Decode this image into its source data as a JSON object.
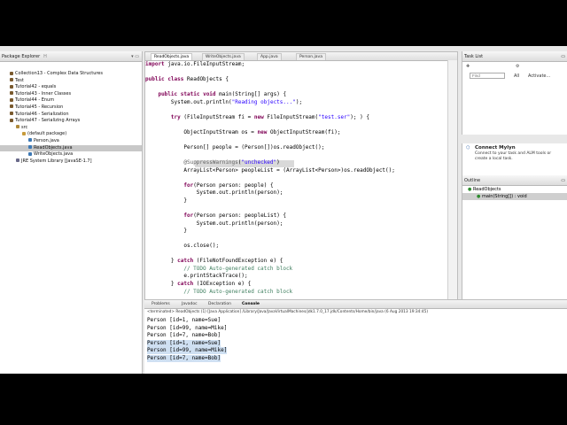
{
  "package_explorer": {
    "title": "Package Explorer",
    "hierarchy_label": "H",
    "items": [
      {
        "label": "Collection13 - Complex Data Structures",
        "indent": 1
      },
      {
        "label": "Test",
        "indent": 1
      },
      {
        "label": "Tutorial42 - equals",
        "indent": 1
      },
      {
        "label": "Tutorial43 - Inner Classes",
        "indent": 1
      },
      {
        "label": "Tutorial44 - Enum",
        "indent": 1
      },
      {
        "label": "Tutorial45 - Recursion",
        "indent": 1
      },
      {
        "label": "Tutorial46 - Serialization",
        "indent": 1
      },
      {
        "label": "Tutorial47 - Serializing Arrays",
        "indent": 1
      },
      {
        "label": "src",
        "indent": 2
      },
      {
        "label": "(default package)",
        "indent": 3
      },
      {
        "label": "Person.java",
        "indent": 4
      },
      {
        "label": "ReadObjects.java",
        "indent": 4,
        "selected": true
      },
      {
        "label": "WriteObjects.java",
        "indent": 4
      },
      {
        "label": "JRE System Library [JavaSE-1.7]",
        "indent": 2
      }
    ]
  },
  "editor": {
    "tabs": [
      "ReadObjects.java",
      "WriteObjects.java",
      "App.java",
      "Person.java"
    ],
    "lines": [
      "import java.io.FileInputStream;",
      "",
      "public class ReadObjects {",
      "",
      "    public static void main(String[] args) {",
      "        System.out.println(\"Reading objects...\");",
      "",
      "        try (FileInputStream fi = new FileInputStream(\"test.ser\"); ) {",
      "",
      "            ObjectInputStream os = new ObjectInputStream(fi);",
      "",
      "            Person[] people = (Person[])os.readObject();",
      "",
      "            @SuppressWarnings(\"unchecked\")",
      "            ArrayList<Person> peopleList = (ArrayList<Person>)os.readObject();",
      "",
      "            for(Person person: people) {",
      "                System.out.println(person);",
      "            }",
      "",
      "            for(Person person: peopleList) {",
      "                System.out.println(person);",
      "            }",
      "",
      "            os.close();",
      "",
      "        } catch (FileNotFoundException e) {",
      "            // TODO Auto-generated catch block",
      "            e.printStackTrace();",
      "        } catch (IOException e) {",
      "            // TODO Auto-generated catch block"
    ]
  },
  "task_list": {
    "title": "Task List",
    "find_placeholder": "Find",
    "all_label": "All",
    "activate_label": "Activate..."
  },
  "mylyn": {
    "title": "Connect Mylyn",
    "text1": "Connect to your task and ALM tools or",
    "text2": "create a local task."
  },
  "outline": {
    "title": "Outline",
    "items": [
      "ReadObjects",
      "main(String[]) : void"
    ]
  },
  "console": {
    "tabs": [
      "Problems",
      "Javadoc",
      "Declaration",
      "Console"
    ],
    "header": "<terminated> ReadObjects (1) [Java Application] /Library/Java/JavaVirtualMachines/jdk1.7.0_17.jdk/Contents/Home/bin/java (6 Aug 2013 19:34:45)",
    "lines": [
      {
        "text": "Person [id=1, name=Sue]",
        "selected": false
      },
      {
        "text": "Person [id=99, name=Mike]",
        "selected": false
      },
      {
        "text": "Person [id=7, name=Bob]",
        "selected": false
      },
      {
        "text": "Person [id=1, name=Sue]",
        "selected": true
      },
      {
        "text": "Person [id=99, name=Mike]",
        "selected": true
      },
      {
        "text": "Person [id=7, name=Bob]",
        "selected": true
      }
    ]
  },
  "colors": {
    "keyword": "#7f0055",
    "string": "#2a00ff",
    "comment": "#3f7f5f",
    "annotation": "#646464"
  }
}
